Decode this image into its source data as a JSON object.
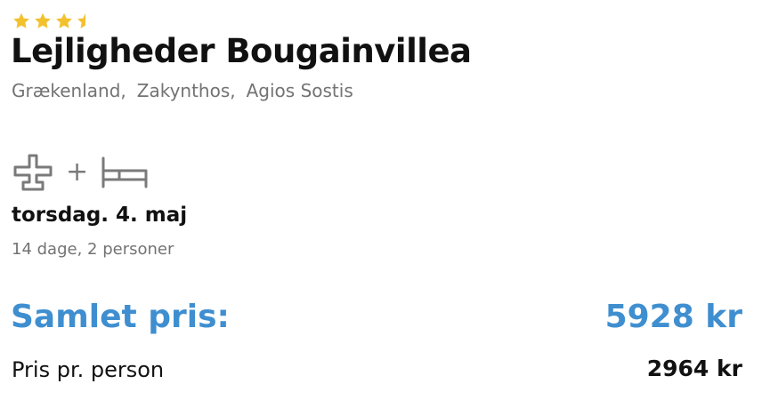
{
  "hotel": {
    "rating": 3.5,
    "rating_max": 4,
    "star_color": "#f2c12e",
    "name": "Lejligheder Bougainvillea",
    "location": [
      "Grækenland,",
      "Zakynthos,",
      "Agios Sostis"
    ]
  },
  "trip": {
    "icons": [
      "airplane-icon",
      "bed-icon"
    ],
    "plus": "+",
    "date": "torsdag. 4. maj",
    "details": "14 dage, 2 personer"
  },
  "price": {
    "total_label": "Samlet pris:",
    "total_value": "5928 kr",
    "per_person_label": "Pris pr. person",
    "per_person_value": "2964 kr",
    "accent_color": "#3f8fd0"
  }
}
